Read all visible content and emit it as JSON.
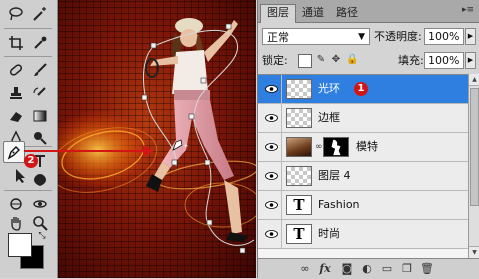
{
  "layers_panel": {
    "tabs": [
      {
        "label": "图层",
        "active": true
      },
      {
        "label": "通道",
        "active": false
      },
      {
        "label": "路径",
        "active": false
      }
    ],
    "menu_glyph": "▸≡",
    "blend_mode": "正常",
    "opacity_label": "不透明度:",
    "opacity_value": "100%",
    "lock_label": "锁定:",
    "fill_label": "填充:",
    "fill_value": "100%",
    "layers": [
      {
        "name": "光环",
        "thumbnail": "transparent",
        "selected": true,
        "visible": true
      },
      {
        "name": "边框",
        "thumbnail": "transparent",
        "selected": false,
        "visible": true
      },
      {
        "name": "模特",
        "thumbnail": "photo-with-mask",
        "selected": false,
        "visible": true
      },
      {
        "name": "图层 4",
        "thumbnail": "transparent",
        "selected": false,
        "visible": true
      },
      {
        "name": "Fashion",
        "thumbnail": "text",
        "selected": false,
        "visible": true
      },
      {
        "name": "时尚",
        "thumbnail": "text",
        "selected": false,
        "visible": true
      }
    ],
    "text_thumb_glyph": "T",
    "bottom_icons": [
      "link-icon",
      "fx-icon",
      "mask-icon",
      "adjustment-icon",
      "group-icon",
      "new-layer-icon",
      "trash-icon"
    ],
    "fx_label": "fx"
  },
  "callouts": {
    "layer_badge": "1",
    "tool_badge": "2",
    "badge_color": "#d41515"
  },
  "toolbox": {
    "active_tool": "pen-tool",
    "foreground_color": "#ffffff",
    "background_color": "#000000"
  },
  "colors": {
    "selection_blue": "#2f7fe0",
    "canvas_red": "#7d1608"
  }
}
